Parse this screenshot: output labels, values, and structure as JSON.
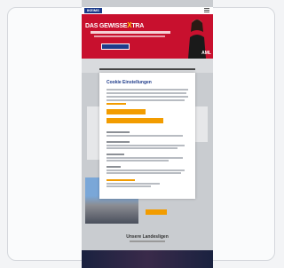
{
  "site": {
    "logo_text": "IKEIMS"
  },
  "banner": {
    "title_part1": "DAS GEWISSE",
    "title_x": "X",
    "title_part2": "TRA",
    "brand_text": "AML"
  },
  "consent": {
    "title": "Cookie Einstellungen"
  },
  "footer": {
    "title": "Unsere Landesligen"
  },
  "colors": {
    "brand_blue": "#1e3b8a",
    "banner_red": "#c8102e",
    "accent_orange": "#f29c00"
  }
}
